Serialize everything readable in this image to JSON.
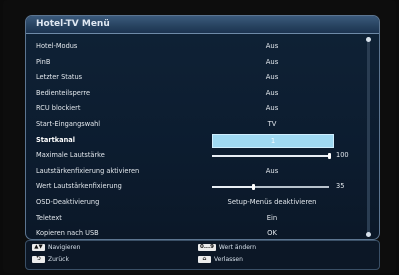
{
  "menu": {
    "title": "Hotel-TV Menü",
    "rows": [
      {
        "label": "Hotel-Modus",
        "value": "Aus"
      },
      {
        "label": "PinB",
        "value": "Aus"
      },
      {
        "label": "Letzter Status",
        "value": "Aus"
      },
      {
        "label": "Bedienteilsperre",
        "value": "Aus"
      },
      {
        "label": "RCU blockiert",
        "value": "Aus"
      },
      {
        "label": "Start-Eingangswahl",
        "value": "TV"
      },
      {
        "label": "Startkanal",
        "value": "1"
      },
      {
        "label": "Maximale Lautstärke",
        "value": "100",
        "level": 1.0
      },
      {
        "label": "Lautstärkenfixierung aktivieren",
        "value": "Aus"
      },
      {
        "label": "Wert Lautstärkenfixierung",
        "value": "35",
        "level": 0.35
      },
      {
        "label": "OSD-Deaktivierung",
        "value": "Setup-Menüs deaktivieren"
      },
      {
        "label": "Teletext",
        "value": "Ein"
      },
      {
        "label": "Kopieren nach USB",
        "value": "OK"
      }
    ]
  },
  "legend": {
    "navigate_key": "▲▼",
    "navigate_label": "Navigieren",
    "back_key": "⮌",
    "back_label": "Zurück",
    "digits_key": "0...9",
    "digits_label": "Wert ändern",
    "home_key": "⌂",
    "exit_label": "Verlassen"
  }
}
